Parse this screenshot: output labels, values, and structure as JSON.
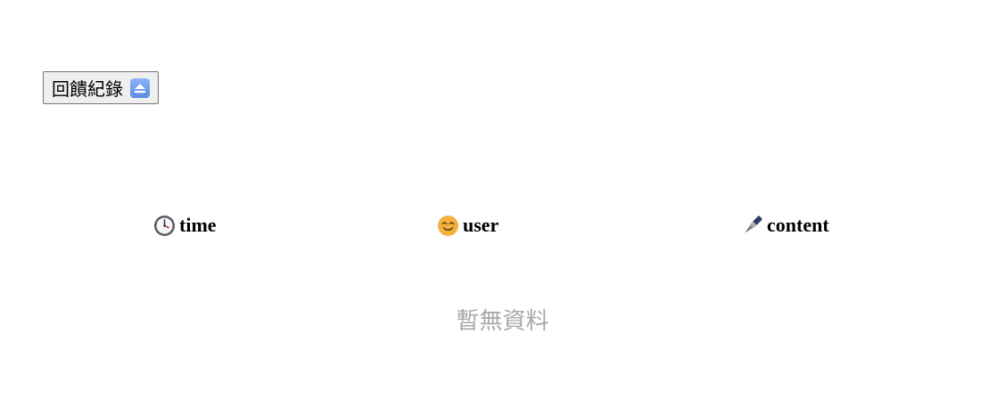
{
  "toolbar": {
    "feedback_label": "回饋紀錄",
    "feedback_icon": "eject-icon"
  },
  "table": {
    "columns": [
      {
        "key": "time",
        "label": "time",
        "icon": "clock-icon"
      },
      {
        "key": "user",
        "label": "user",
        "icon": "smiling-face-icon"
      },
      {
        "key": "content",
        "label": "content",
        "icon": "fountain-pen-icon"
      }
    ],
    "rows": [],
    "empty_text": "暫無資料"
  },
  "colors": {
    "button_bg": "#efefef",
    "button_border": "#767676",
    "eject_blue": "#5b8be6",
    "empty_text": "#a8a8a8"
  }
}
